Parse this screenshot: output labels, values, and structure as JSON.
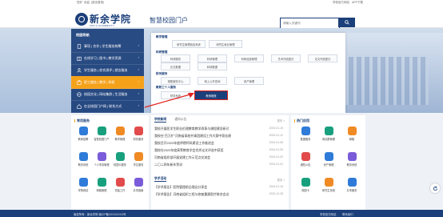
{
  "topbar": {
    "left_items": [
      "您好",
      "欢迎",
      "(退出登录)"
    ],
    "right_items": [
      "学校官方网站",
      "APP下载"
    ]
  },
  "header": {
    "brand_name": "新余学院",
    "brand_sub": "XINYU UNIVERSITY",
    "portal_title": "智慧校园门户",
    "search_placeholder": "请输入关键词"
  },
  "sidenav": {
    "title": "校园导航",
    "items": [
      {
        "label": "事项 | 合作 | 学生服务统筹",
        "icon": "building-icon"
      },
      {
        "label": "在线学习 | 图书 | 教学资源",
        "icon": "book-icon"
      },
      {
        "label": "学生服务 | 综合测评 | 就业服务",
        "icon": "user-icon"
      },
      {
        "label": "职工服务 | 教学 | 科研",
        "icon": "briefcase-icon",
        "active": true
      },
      {
        "label": "校园文化 | 网站集群 | 生活服务",
        "icon": "globe-icon"
      },
      {
        "label": "在全校园门户网 | 联系方式",
        "icon": "home-icon"
      }
    ]
  },
  "menu_panel": {
    "groups": [
      {
        "title": "教学管理",
        "items": [
          "研究生管理信息系统",
          "研究生就业管理"
        ]
      },
      {
        "title": "科研管理",
        "items": [
          "科研服务",
          "科研管理",
          "科研经费管理",
          "艺术作品登记",
          "论文作品登记",
          "论文数据",
          "科研数据"
        ]
      },
      {
        "title": "财务服务",
        "items": [
          "报账服务中心",
          "网上公开查询",
          "资产管理"
        ]
      },
      {
        "title": "教职工个人服务",
        "items": [
          "财务系统",
          "教师报账"
        ]
      }
    ],
    "highlight": "教师报账"
  },
  "services": {
    "title": "常用服务",
    "tiles": [
      {
        "label": "教师招聘",
        "color": "#2f7bd9"
      },
      {
        "label": "智慧校园门户",
        "color": "#18a07e"
      },
      {
        "label": "教学管理",
        "color": "#f08a24"
      },
      {
        "label": "财务服务",
        "color": "#e14b4b"
      },
      {
        "label": "教务系统",
        "color": "#2f7bd9"
      },
      {
        "label": "个人事务管理",
        "color": "#7a5bd9"
      },
      {
        "label": "校园卡服务",
        "color": "#18a07e"
      },
      {
        "label": "学生服务",
        "color": "#f08a24"
      },
      {
        "label": "学院网站",
        "color": "#2f7bd9"
      },
      {
        "label": "邮箱管理",
        "color": "#18a07e"
      },
      {
        "label": "党建工作",
        "color": "#e14b4b"
      },
      {
        "label": "办事指南",
        "color": "#7a5bd9"
      }
    ]
  },
  "news": {
    "tabs": [
      "学校新闻",
      "通知公告"
    ],
    "more": "更多 >",
    "items": [
      {
        "title": "我校开展医学生职业伦理教育教学改革与课程建设研讨",
        "date": "2024-01-15"
      },
      {
        "title": "我校在“百万扩”河南省高校共青团建设工作大赛中获佳绩",
        "date": "2024-01-12"
      },
      {
        "title": "我校召开2023年度师德师风建设工作推进会",
        "date": "2024-01-08"
      },
      {
        "title": "我校在2023年度高等教育学会优秀论文评选中获奖",
        "date": "2024-01-05"
      },
      {
        "title": "河南省组织部开展党建工作示范点交流会",
        "date": "2024-01-02"
      },
      {
        "title": "二〇二四年新年贺词",
        "date": "2024-01-01"
      }
    ],
    "tabs2": [
      "学术活动"
    ],
    "items2": [
      {
        "title": "【学术报告】医院管理前沿理念分享会",
        "date": "2024-01-16"
      },
      {
        "title": "【学术报告】河南省组织工程与修复重建医疗联合会议",
        "date": "2023-12-28"
      }
    ]
  },
  "quick": {
    "title": "热门应用",
    "tiles": [
      {
        "label": "数据服务",
        "color": "#2f7bd9"
      },
      {
        "label": "网站群管理",
        "color": "#18a07e"
      },
      {
        "label": "邮箱",
        "color": "#f08a24"
      },
      {
        "label": "通知公告",
        "color": "#e14b4b"
      },
      {
        "label": "资产管理",
        "color": "#2f7bd9"
      },
      {
        "label": "教务系统",
        "color": "#7a5bd9"
      },
      {
        "label": "校园卡",
        "color": "#18a07e"
      },
      {
        "label": "研究生系统",
        "color": "#f08a24"
      },
      {
        "label": "办事服务",
        "color": "#2f7bd9"
      }
    ]
  },
  "footer": {
    "left": "版权所有：新余学院  赣ICP备XXXXXXXX号",
    "right_items": [
      "学校官方网站",
      "联系我们"
    ]
  },
  "colors": {
    "primary": "#1b3f7a",
    "accent": "#f5a21b",
    "highlight_border": "#e4231c"
  }
}
